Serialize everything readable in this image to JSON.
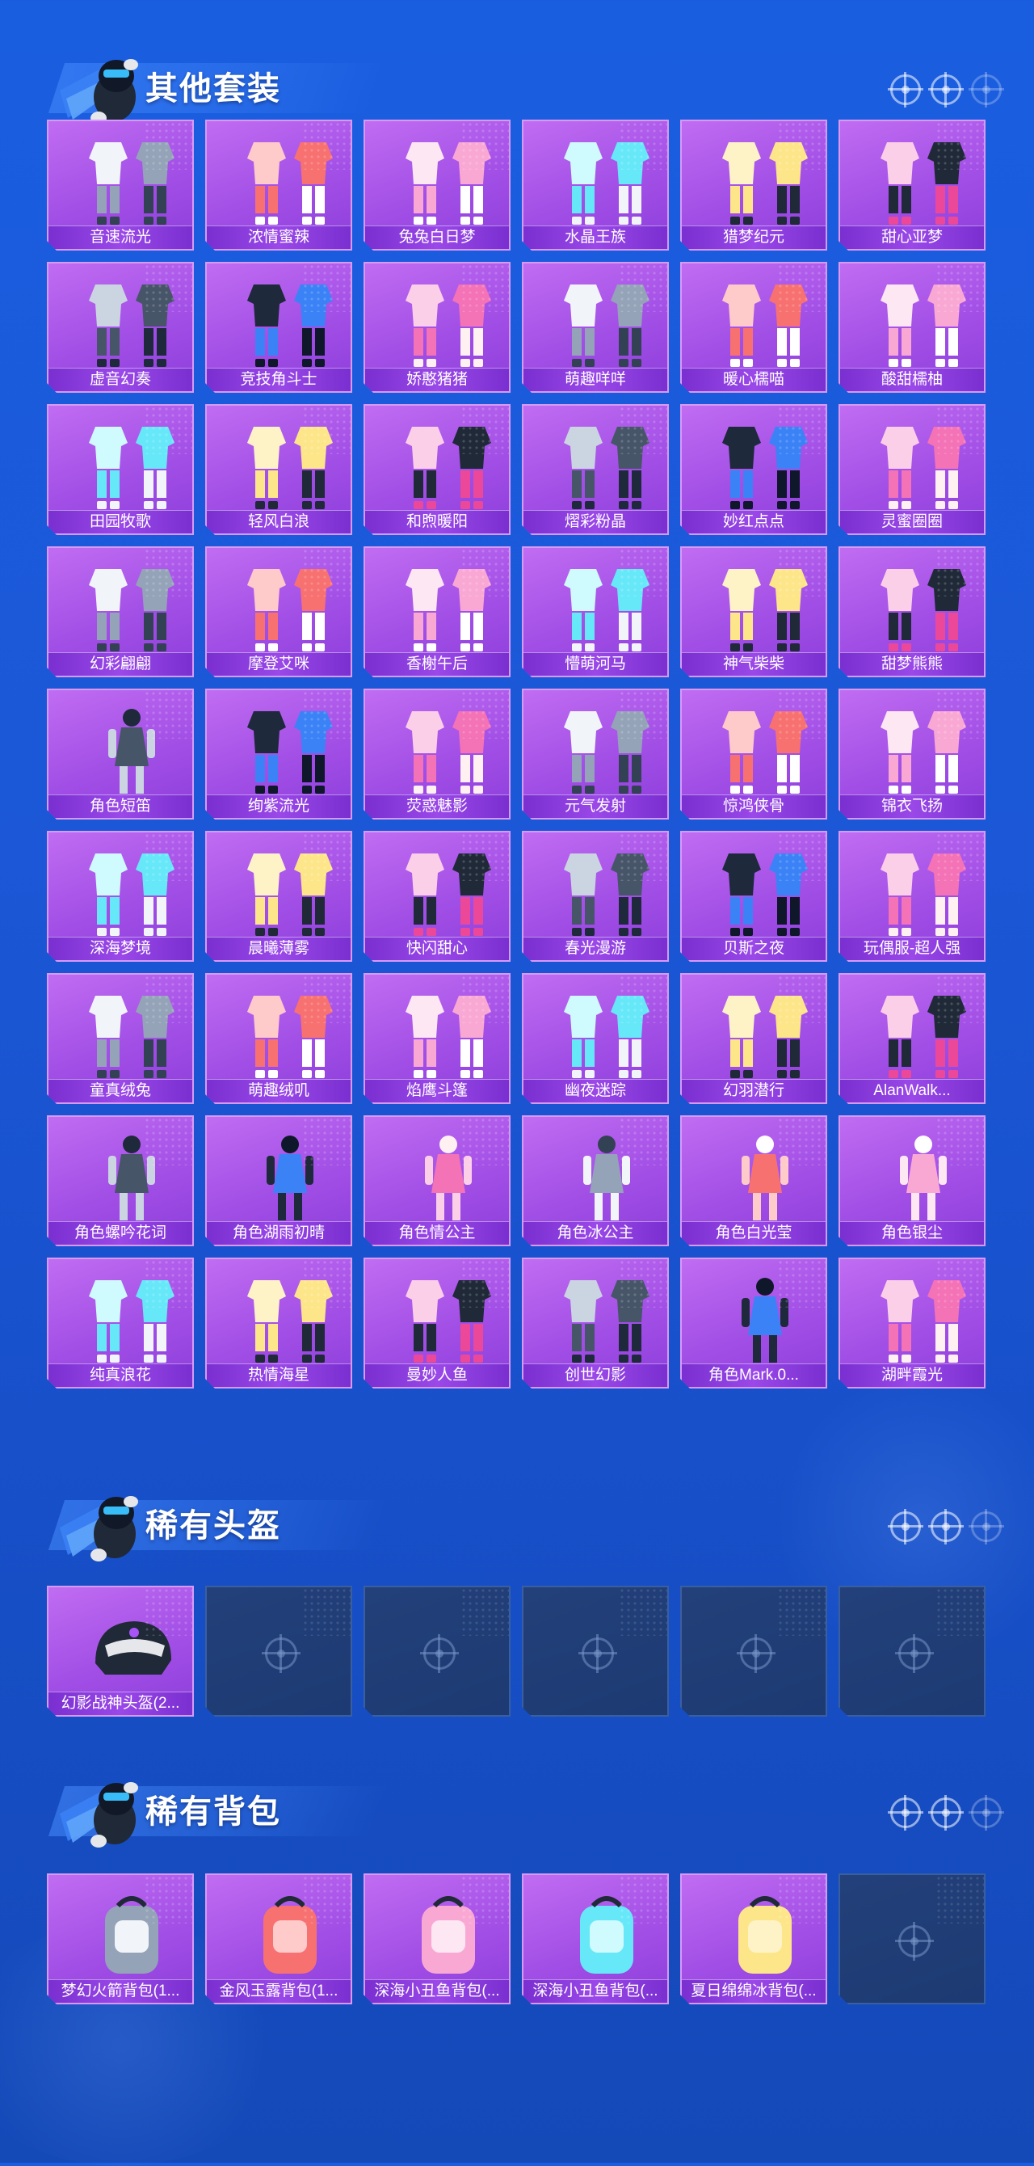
{
  "sections": [
    {
      "title": "其他套装",
      "items": [
        {
          "name": "音速流光",
          "icon": "outfit-icon"
        },
        {
          "name": "浓情蜜辣",
          "icon": "outfit-icon"
        },
        {
          "name": "兔兔白日梦",
          "icon": "outfit-icon"
        },
        {
          "name": "水晶王族",
          "icon": "outfit-icon"
        },
        {
          "name": "猎梦纪元",
          "icon": "outfit-icon"
        },
        {
          "name": "甜心亚梦",
          "icon": "outfit-icon"
        },
        {
          "name": "虚音幻奏",
          "icon": "outfit-icon"
        },
        {
          "name": "竞技角斗士",
          "icon": "outfit-icon"
        },
        {
          "name": "娇憨猪猪",
          "icon": "outfit-icon"
        },
        {
          "name": "萌趣咩咩",
          "icon": "outfit-icon"
        },
        {
          "name": "暖心檽喵",
          "icon": "outfit-icon"
        },
        {
          "name": "酸甜檽柚",
          "icon": "outfit-icon"
        },
        {
          "name": "田园牧歌",
          "icon": "outfit-icon"
        },
        {
          "name": "轻风白浪",
          "icon": "outfit-icon"
        },
        {
          "name": "和煦暖阳",
          "icon": "outfit-icon"
        },
        {
          "name": "熠彩粉晶",
          "icon": "outfit-icon"
        },
        {
          "name": "妙红点点",
          "icon": "outfit-icon"
        },
        {
          "name": "灵蜜圈圈",
          "icon": "outfit-icon"
        },
        {
          "name": "幻彩翩翩",
          "icon": "outfit-icon"
        },
        {
          "name": "摩登艾咪",
          "icon": "outfit-icon"
        },
        {
          "name": "香榭午后",
          "icon": "outfit-icon"
        },
        {
          "name": "懵萌河马",
          "icon": "outfit-icon"
        },
        {
          "name": "神气柴柴",
          "icon": "outfit-icon"
        },
        {
          "name": "甜梦熊熊",
          "icon": "outfit-icon"
        },
        {
          "name": "角色短笛",
          "icon": "character-icon"
        },
        {
          "name": "绚紫流光",
          "icon": "outfit-icon"
        },
        {
          "name": "荧惑魅影",
          "icon": "outfit-icon"
        },
        {
          "name": "元气发射",
          "icon": "outfit-icon"
        },
        {
          "name": "惊鸿侠骨",
          "icon": "outfit-icon"
        },
        {
          "name": "锦衣飞扬",
          "icon": "outfit-icon"
        },
        {
          "name": "深海梦境",
          "icon": "outfit-icon"
        },
        {
          "name": "晨曦薄雾",
          "icon": "outfit-icon"
        },
        {
          "name": "快闪甜心",
          "icon": "outfit-icon"
        },
        {
          "name": "春光漫游",
          "icon": "outfit-icon"
        },
        {
          "name": "贝斯之夜",
          "icon": "outfit-icon"
        },
        {
          "name": "玩偶服-超人强",
          "icon": "outfit-icon"
        },
        {
          "name": "童真绒兔",
          "icon": "outfit-icon"
        },
        {
          "name": "萌趣绒叽",
          "icon": "outfit-icon"
        },
        {
          "name": "焰鹰斗篷",
          "icon": "outfit-icon"
        },
        {
          "name": "幽夜迷踪",
          "icon": "outfit-icon"
        },
        {
          "name": "幻羽潜行",
          "icon": "outfit-icon"
        },
        {
          "name": "AlanWalk...",
          "icon": "outfit-icon"
        },
        {
          "name": "角色螺吟花词",
          "icon": "character-icon"
        },
        {
          "name": "角色湖雨初晴",
          "icon": "character-icon"
        },
        {
          "name": "角色情公主",
          "icon": "character-icon"
        },
        {
          "name": "角色冰公主",
          "icon": "character-icon"
        },
        {
          "name": "角色白光莹",
          "icon": "character-icon"
        },
        {
          "name": "角色银尘",
          "icon": "character-icon"
        },
        {
          "name": "纯真浪花",
          "icon": "outfit-icon"
        },
        {
          "name": "热情海星",
          "icon": "outfit-icon"
        },
        {
          "name": "曼妙人鱼",
          "icon": "outfit-icon"
        },
        {
          "name": "创世幻影",
          "icon": "outfit-icon"
        },
        {
          "name": "角色Mark.0...",
          "icon": "character-icon"
        },
        {
          "name": "湖畔霞光",
          "icon": "outfit-icon"
        }
      ]
    },
    {
      "title": "稀有头盔",
      "items": [
        {
          "name": "幻影战神头盔(2...",
          "icon": "helmet-icon"
        }
      ],
      "empty_slots": 5
    },
    {
      "title": "稀有背包",
      "items": [
        {
          "name": "梦幻火箭背包(1...",
          "icon": "backpack-icon"
        },
        {
          "name": "金风玉露背包(1...",
          "icon": "backpack-icon"
        },
        {
          "name": "深海小丑鱼背包(...",
          "icon": "backpack-icon"
        },
        {
          "name": "深海小丑鱼背包(...",
          "icon": "backpack-icon"
        },
        {
          "name": "夏日绵绵冰背包(...",
          "icon": "backpack-icon"
        }
      ],
      "empty_slots": 1
    }
  ],
  "colors": {
    "background": "#1a5ee0",
    "card_purple": "#a24fe6",
    "card_label": "#7a2fd0",
    "card_empty": "#1d3a73"
  }
}
